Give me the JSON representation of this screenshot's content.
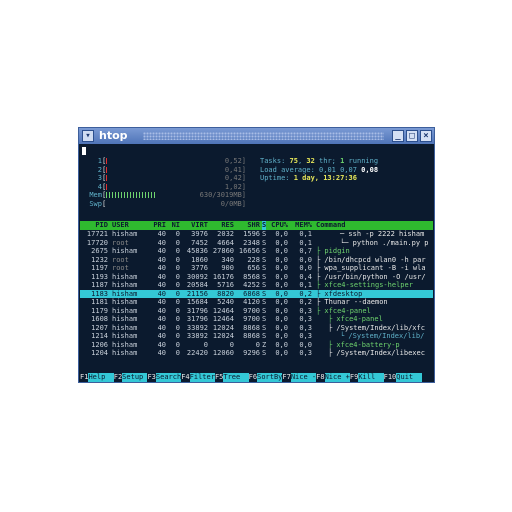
{
  "window": {
    "title": "htop"
  },
  "meters": [
    {
      "label": "1",
      "value": "0,52]",
      "fill": 0.02,
      "color": "#e03030"
    },
    {
      "label": "2",
      "value": "0,41]",
      "fill": 0.02,
      "color": "#e03030"
    },
    {
      "label": "3",
      "value": "0,42]",
      "fill": 0.02,
      "color": "#e03030"
    },
    {
      "label": "4",
      "value": "1,02]",
      "fill": 0.03,
      "color": "#e03030"
    },
    {
      "label": "Mem",
      "value": "630/3019MB]",
      "fill": 0.45,
      "color": "#6ed36e"
    },
    {
      "label": "Swp",
      "value": "0/0MB]",
      "fill": 0.0,
      "color": "#e03030"
    }
  ],
  "summary": {
    "tasks_label": "Tasks: ",
    "tasks": "75",
    "thr_label": " thr; ",
    "thr": "1",
    "running_label": " running",
    "thr_count": "32",
    "load_label": "Load average: ",
    "load1": "0,01",
    "load5": "0,07",
    "load15": "0,08",
    "uptime_label": "Uptime: ",
    "uptime": "1 day, 13:27:36"
  },
  "header": {
    "pid": "PID",
    "user": "USER",
    "pri": "PRI",
    "ni": "NI",
    "virt": "VIRT",
    "res": "RES",
    "shr": "SHR",
    "s": "S",
    "cpu": "CPU%",
    "mem": "MEM%",
    "command": "Command"
  },
  "processes": [
    {
      "pid": "17721",
      "user": "hisham",
      "pri": "40",
      "ni": "0",
      "virt": "3976",
      "res": "2032",
      "shr": "1596",
      "s": "S",
      "cpu": "0,0",
      "mem": "0,1",
      "tree": "    ",
      "command": "─ ssh -p 2222 hisham",
      "style": "cmd"
    },
    {
      "pid": "17720",
      "user": "root",
      "pri": "40",
      "ni": "0",
      "virt": "7452",
      "res": "4664",
      "shr": "2348",
      "s": "S",
      "cpu": "0,0",
      "mem": "0,1",
      "tree": "    ",
      "command": "└─ python ./main.py p",
      "style": "cmd"
    },
    {
      "pid": "2675",
      "user": "hisham",
      "pri": "40",
      "ni": "0",
      "virt": "45836",
      "res": "27860",
      "shr": "16656",
      "s": "S",
      "cpu": "0,0",
      "mem": "0,7",
      "tree": "",
      "command": "├ pidgin",
      "style": "green"
    },
    {
      "pid": "1232",
      "user": "root",
      "pri": "40",
      "ni": "0",
      "virt": "1860",
      "res": "340",
      "shr": "228",
      "s": "S",
      "cpu": "0,0",
      "mem": "0,0",
      "tree": "",
      "command": "├ /bin/dhcpcd wlan0 -h par",
      "style": "cmd"
    },
    {
      "pid": "1197",
      "user": "root",
      "pri": "40",
      "ni": "0",
      "virt": "3776",
      "res": "900",
      "shr": "656",
      "s": "S",
      "cpu": "0,0",
      "mem": "0,0",
      "tree": "",
      "command": "├ wpa_supplicant -B -i wla",
      "style": "cmd"
    },
    {
      "pid": "1193",
      "user": "hisham",
      "pri": "40",
      "ni": "0",
      "virt": "30092",
      "res": "16176",
      "shr": "8568",
      "s": "S",
      "cpu": "0,0",
      "mem": "0,4",
      "tree": "",
      "command": "├ /usr/bin/python -O /usr/",
      "style": "cmd"
    },
    {
      "pid": "1187",
      "user": "hisham",
      "pri": "40",
      "ni": "0",
      "virt": "20584",
      "res": "5716",
      "shr": "4252",
      "s": "S",
      "cpu": "0,0",
      "mem": "0,1",
      "tree": "",
      "command": "├ xfce4-settings-helper",
      "style": "green"
    },
    {
      "pid": "1183",
      "user": "hisham",
      "pri": "40",
      "ni": "0",
      "virt": "21156",
      "res": "8820",
      "shr": "6868",
      "s": "S",
      "cpu": "0,0",
      "mem": "0,2",
      "tree": "",
      "command": "├ xfdesktop",
      "style": "sel"
    },
    {
      "pid": "1181",
      "user": "hisham",
      "pri": "40",
      "ni": "0",
      "virt": "15684",
      "res": "5240",
      "shr": "4120",
      "s": "S",
      "cpu": "0,0",
      "mem": "0,2",
      "tree": "",
      "command": "├ Thunar --daemon",
      "style": "cmd"
    },
    {
      "pid": "1179",
      "user": "hisham",
      "pri": "40",
      "ni": "0",
      "virt": "31796",
      "res": "12464",
      "shr": "9700",
      "s": "S",
      "cpu": "0,0",
      "mem": "0,3",
      "tree": "",
      "command": "├ xfce4-panel",
      "style": "green"
    },
    {
      "pid": "1608",
      "user": "hisham",
      "pri": "40",
      "ni": "0",
      "virt": "31796",
      "res": "12464",
      "shr": "9700",
      "s": "S",
      "cpu": "0,0",
      "mem": "0,3",
      "tree": "  ",
      "command": "├ xfce4-panel",
      "style": "green"
    },
    {
      "pid": "1207",
      "user": "hisham",
      "pri": "40",
      "ni": "0",
      "virt": "33892",
      "res": "12024",
      "shr": "8868",
      "s": "S",
      "cpu": "0,0",
      "mem": "0,3",
      "tree": "  ",
      "command": "├ /System/Index/lib/xfc",
      "style": "cmd"
    },
    {
      "pid": "1214",
      "user": "hisham",
      "pri": "40",
      "ni": "0",
      "virt": "33892",
      "res": "12024",
      "shr": "8868",
      "s": "S",
      "cpu": "0,0",
      "mem": "0,3",
      "tree": "    ",
      "command": "└ /System/Index/lib/",
      "style": "cyan"
    },
    {
      "pid": "1206",
      "user": "hisham",
      "pri": "40",
      "ni": "0",
      "virt": "0",
      "res": "0",
      "shr": "0",
      "s": "Z",
      "cpu": "0,0",
      "mem": "0,0",
      "tree": "  ",
      "command": "├ xfce4-battery-p",
      "style": "green"
    },
    {
      "pid": "1204",
      "user": "hisham",
      "pri": "40",
      "ni": "0",
      "virt": "22420",
      "res": "12060",
      "shr": "9296",
      "s": "S",
      "cpu": "0,0",
      "mem": "0,3",
      "tree": "  ",
      "command": "├ /System/Index/libexec",
      "style": "cmd"
    }
  ],
  "footer": [
    {
      "key": "F1",
      "label": "Help  "
    },
    {
      "key": "F2",
      "label": "Setup "
    },
    {
      "key": "F3",
      "label": "Search"
    },
    {
      "key": "F4",
      "label": "Filter"
    },
    {
      "key": "F5",
      "label": "Tree  "
    },
    {
      "key": "F6",
      "label": "SortBy"
    },
    {
      "key": "F7",
      "label": "Nice -"
    },
    {
      "key": "F8",
      "label": "Nice +"
    },
    {
      "key": "F9",
      "label": "Kill  "
    },
    {
      "key": "F10",
      "label": "Quit  "
    }
  ]
}
